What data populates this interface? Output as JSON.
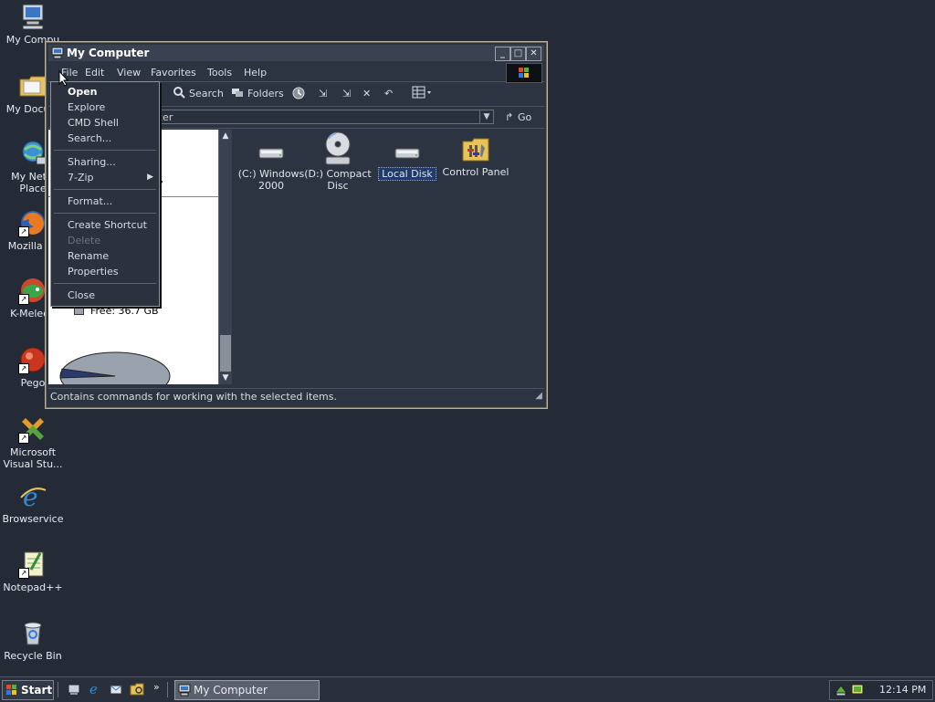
{
  "desktop": {
    "icons": [
      {
        "label": "My Computer",
        "icon": "computer-icon"
      },
      {
        "label": "My Documents",
        "icon": "documents-folder-icon"
      },
      {
        "label": "My Network Places",
        "icon": "network-places-icon"
      },
      {
        "label": "Mozilla Firefox",
        "icon": "firefox-icon"
      },
      {
        "label": "K-Meleon",
        "icon": "kmeleon-icon"
      },
      {
        "label": "Pego",
        "icon": "pego-icon"
      },
      {
        "label": "Microsoft Visual Stu...",
        "icon": "visual-studio-icon"
      },
      {
        "label": "Browservice",
        "icon": "ie-icon"
      },
      {
        "label": "Notepad++",
        "icon": "notepadpp-icon"
      },
      {
        "label": "Recycle Bin",
        "icon": "recycle-bin-icon"
      }
    ],
    "visible_labels": {
      "my_computer": "My Compu",
      "my_documents": "My Docum",
      "network_1": "My Netw",
      "network_2": "Place",
      "firefox": "Mozilla Fir",
      "kmeleon": "K-Meleon",
      "pego": "Pego",
      "vs_1": "Microsoft",
      "vs_2": "Visual Stu...",
      "browservice": "Browservice",
      "notepadpp": "Notepad++",
      "recycle": "Recycle Bin"
    }
  },
  "window": {
    "title": "My Computer",
    "menus": [
      "File",
      "Edit",
      "View",
      "Favorites",
      "Tools",
      "Help"
    ],
    "toolbar": {
      "search_label": "Search",
      "folders_label": "Folders"
    },
    "address": {
      "value": "cer",
      "go_label": "Go"
    },
    "left_pane": {
      "free_label": "Free: 36.7 GB",
      "title_fragment": "r"
    },
    "files": [
      {
        "label_1": "(C:) Windows",
        "label_2": "2000",
        "icon": "hard-drive-icon"
      },
      {
        "label_1": "(D:) Compact",
        "label_2": "Disc",
        "icon": "cd-drive-icon"
      },
      {
        "label_1": "Local Disk",
        "label_2": "",
        "icon": "hard-drive-icon",
        "selected": true
      },
      {
        "label_1": "Control Panel",
        "label_2": "",
        "icon": "control-panel-icon"
      }
    ],
    "status": "Contains commands for working with the selected items."
  },
  "context_menu": {
    "items": [
      {
        "label": "Open",
        "bold": true
      },
      {
        "label": "Explore"
      },
      {
        "label": "CMD Shell"
      },
      {
        "label": "Search..."
      },
      {
        "label": "Sharing..."
      },
      {
        "label": "7-Zip",
        "submenu": true
      },
      {
        "label": "Format..."
      },
      {
        "label": "Create Shortcut"
      },
      {
        "label": "Delete",
        "disabled": true
      },
      {
        "label": "Rename"
      },
      {
        "label": "Properties"
      },
      {
        "label": "Close"
      }
    ]
  },
  "taskbar": {
    "start_label": "Start",
    "task_label": "My Computer",
    "clock": "12:14 PM",
    "overflow": "»"
  },
  "colors": {
    "desktop": "#242b37",
    "selection": "#1f3a6b"
  }
}
